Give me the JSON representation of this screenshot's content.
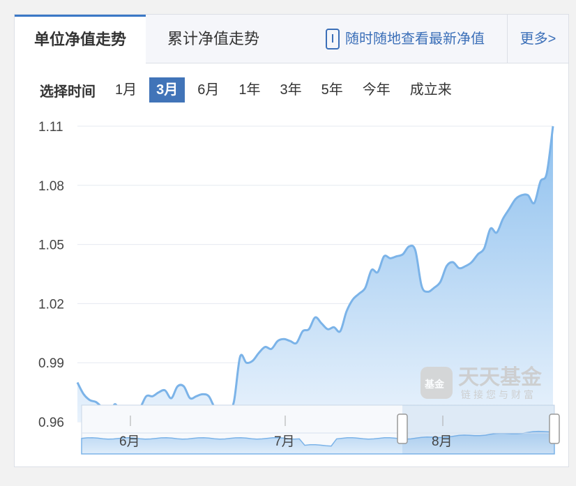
{
  "tabs": {
    "unit_nav": "单位净值走势",
    "cumulative_nav": "累计净值走势",
    "mobile_link": "随时随地查看最新净值",
    "more": "更多>"
  },
  "range_selector": {
    "label": "选择时间",
    "options": [
      "1月",
      "3月",
      "6月",
      "1年",
      "3年",
      "5年",
      "今年",
      "成立来"
    ],
    "active_index": 1
  },
  "watermark": {
    "brand": "天天基金",
    "slogan": "链接您与财富",
    "logo_text": "基金"
  },
  "chart_data": {
    "type": "area",
    "ylim": [
      0.96,
      1.11
    ],
    "yticks": [
      "1.11",
      "1.08",
      "1.05",
      "1.02",
      "0.99",
      "0.96"
    ],
    "grid": true,
    "navigator_labels": [
      "6月",
      "7月",
      "8月"
    ],
    "colors": {
      "line": "#7bb3e8",
      "fill_top": "#8ec0ee",
      "fill_bottom": "#e8f2fc"
    },
    "values": [
      0.98,
      0.974,
      0.971,
      0.97,
      0.967,
      0.963,
      0.969,
      0.964,
      0.964,
      0.965,
      0.967,
      0.973,
      0.973,
      0.975,
      0.976,
      0.972,
      0.978,
      0.978,
      0.972,
      0.973,
      0.974,
      0.973,
      0.967,
      0.966,
      0.966,
      0.97,
      0.993,
      0.99,
      0.991,
      0.995,
      0.998,
      0.997,
      1.001,
      1.002,
      1.001,
      1.0,
      1.006,
      1.007,
      1.013,
      1.01,
      1.007,
      1.008,
      1.006,
      1.016,
      1.022,
      1.025,
      1.028,
      1.037,
      1.036,
      1.044,
      1.043,
      1.044,
      1.045,
      1.049,
      1.047,
      1.029,
      1.026,
      1.028,
      1.031,
      1.039,
      1.041,
      1.038,
      1.039,
      1.041,
      1.045,
      1.048,
      1.058,
      1.056,
      1.063,
      1.068,
      1.073,
      1.075,
      1.075,
      1.071,
      1.082,
      1.086,
      1.11
    ]
  }
}
